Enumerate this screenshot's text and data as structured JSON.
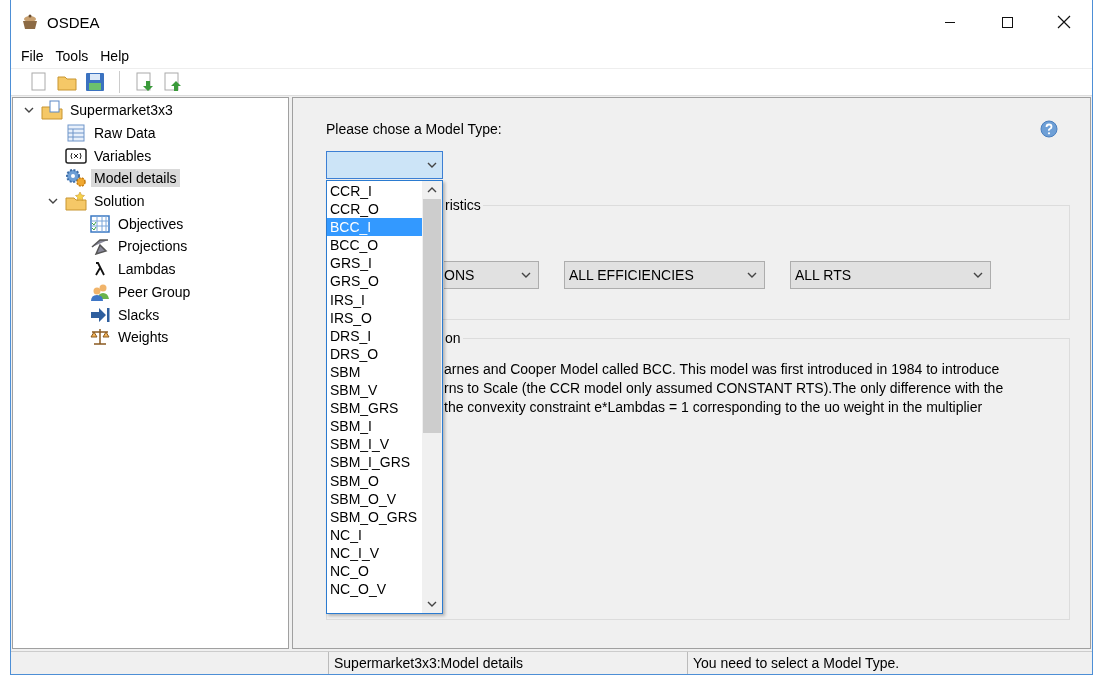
{
  "window": {
    "title": "OSDEA"
  },
  "menu": [
    {
      "label": "File"
    },
    {
      "label": "Tools"
    },
    {
      "label": "Help"
    }
  ],
  "tree": [
    {
      "label": "Supermarket3x3",
      "kind": "project",
      "expanded": true,
      "selected": false,
      "children": [
        {
          "label": "Raw Data",
          "kind": "table",
          "selected": false
        },
        {
          "label": "Variables",
          "kind": "variables",
          "selected": false
        },
        {
          "label": "Model details",
          "kind": "gears",
          "selected": true
        },
        {
          "label": "Solution",
          "kind": "folder",
          "expanded": true,
          "selected": false,
          "children": [
            {
              "label": "Objectives",
              "kind": "grid",
              "selected": false
            },
            {
              "label": "Projections",
              "kind": "projection",
              "selected": false
            },
            {
              "label": "Lambdas",
              "kind": "lambda",
              "selected": false
            },
            {
              "label": "Peer Group",
              "kind": "people",
              "selected": false
            },
            {
              "label": "Slacks",
              "kind": "arrow",
              "selected": false
            },
            {
              "label": "Weights",
              "kind": "scale",
              "selected": false
            }
          ]
        }
      ]
    }
  ],
  "model_type": {
    "label": "Please chose a Model Type:",
    "options": [
      {
        "label": "CCR_I",
        "selected": false
      },
      {
        "label": "CCR_O",
        "selected": false
      },
      {
        "label": "BCC_I",
        "selected": true
      },
      {
        "label": "BCC_O",
        "selected": false
      },
      {
        "label": "GRS_I",
        "selected": false
      },
      {
        "label": "GRS_O",
        "selected": false
      },
      {
        "label": "IRS_I",
        "selected": false
      },
      {
        "label": "IRS_O",
        "selected": false
      },
      {
        "label": "DRS_I",
        "selected": false
      },
      {
        "label": "DRS_O",
        "selected": false
      },
      {
        "label": "SBM",
        "selected": false
      },
      {
        "label": "SBM_V",
        "selected": false
      },
      {
        "label": "SBM_GRS",
        "selected": false
      },
      {
        "label": "SBM_I",
        "selected": false
      },
      {
        "label": "SBM_I_V",
        "selected": false
      },
      {
        "label": "SBM_I_GRS",
        "selected": false
      },
      {
        "label": "SBM_O",
        "selected": false
      },
      {
        "label": "SBM_O_V",
        "selected": false
      },
      {
        "label": "SBM_O_GRS",
        "selected": false
      },
      {
        "label": "NC_I",
        "selected": false
      },
      {
        "label": "NC_I_V",
        "selected": false
      },
      {
        "label": "NC_O",
        "selected": false
      },
      {
        "label": "NC_O_V",
        "selected": false
      }
    ]
  },
  "characteristics": {
    "title": "ristics",
    "selects": [
      {
        "value": "ONS"
      },
      {
        "value": "ALL EFFICIENCIES"
      },
      {
        "value": "ALL RTS"
      }
    ]
  },
  "description": {
    "title": "on",
    "lines": [
      "arnes and Cooper Model called BCC. This model was first introduced in 1984 to introduce",
      "rns to Scale (the CCR model only assumed CONSTANT RTS).The only difference with the",
      "the convexity constraint e*Lambdas = 1 corresponding to the uo weight in the multiplier"
    ]
  },
  "status_bar": {
    "location": "Supermarket3x3:Model details",
    "message": "You need to select a Model Type."
  }
}
